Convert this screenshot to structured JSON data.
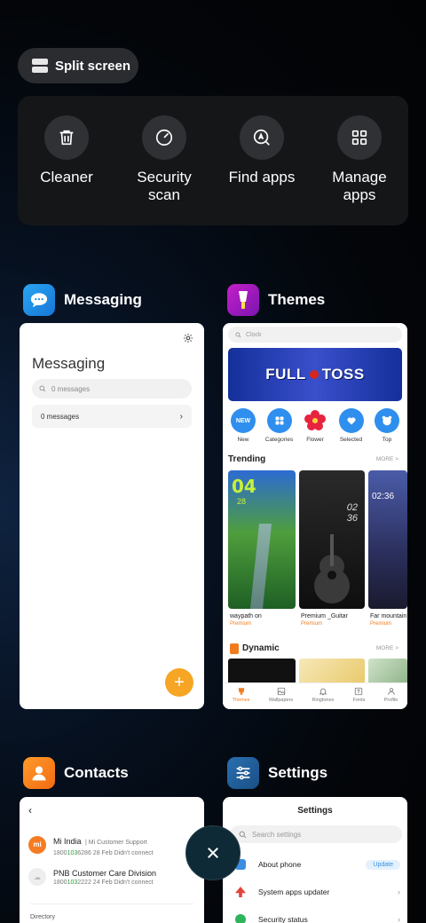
{
  "top": {
    "split_label": "Split screen"
  },
  "quick_actions": [
    {
      "label": "Cleaner",
      "icon": "trash-icon"
    },
    {
      "label": "Security\nscan",
      "icon": "security-scan-icon"
    },
    {
      "label": "Find apps",
      "icon": "find-apps-icon"
    },
    {
      "label": "Manage\napps",
      "icon": "grid-icon"
    }
  ],
  "apps": {
    "messaging": {
      "name": "Messaging",
      "title": "Messaging",
      "search_placeholder": "0 messages",
      "row_label": "0 messages"
    },
    "themes": {
      "name": "Themes",
      "search_placeholder": "Clock",
      "banner_left": "FULL",
      "banner_right": "TOSS",
      "categories": [
        "New",
        "Categories",
        "Flower",
        "Selected",
        "Top"
      ],
      "trending_label": "Trending",
      "more_label": "MORE >",
      "trending": [
        {
          "title": "waypath on",
          "badge": "Premium"
        },
        {
          "title": "Premium _Guitar",
          "badge": "Premium"
        },
        {
          "title": "Far mountain",
          "badge": "Premium"
        }
      ],
      "tile_texts": {
        "clock_big": "04",
        "clock_sub": "28",
        "guitar_time": "02\n36",
        "mountain_time": "02:36"
      },
      "dynamic_label": "Dynamic",
      "nav": [
        "Themes",
        "Wallpapers",
        "Ringtones",
        "Fonts",
        "Profile"
      ]
    },
    "contacts": {
      "name": "Contacts",
      "rows": [
        {
          "name": "Mi India",
          "tag": "Mi Customer Support",
          "num_a": "1800",
          "num_b": "103",
          "num_c": "6286",
          "meta": "28 Feb Didn't connect",
          "avatar": "mi"
        },
        {
          "name": "PNB Customer Care Division",
          "num_a": "1800",
          "num_b": "103",
          "num_c": "2222",
          "meta": "24 Feb Didn't connect"
        }
      ],
      "directory_label": "Directory"
    },
    "settings": {
      "name": "Settings",
      "title": "Settings",
      "search_placeholder": "Search settings",
      "rows": [
        {
          "label": "About phone",
          "action": "Update"
        },
        {
          "label": "System apps updater"
        },
        {
          "label": "Security status"
        }
      ]
    }
  },
  "colors": {
    "fab": "#f7a525",
    "accent_orange": "#f07b1e"
  }
}
